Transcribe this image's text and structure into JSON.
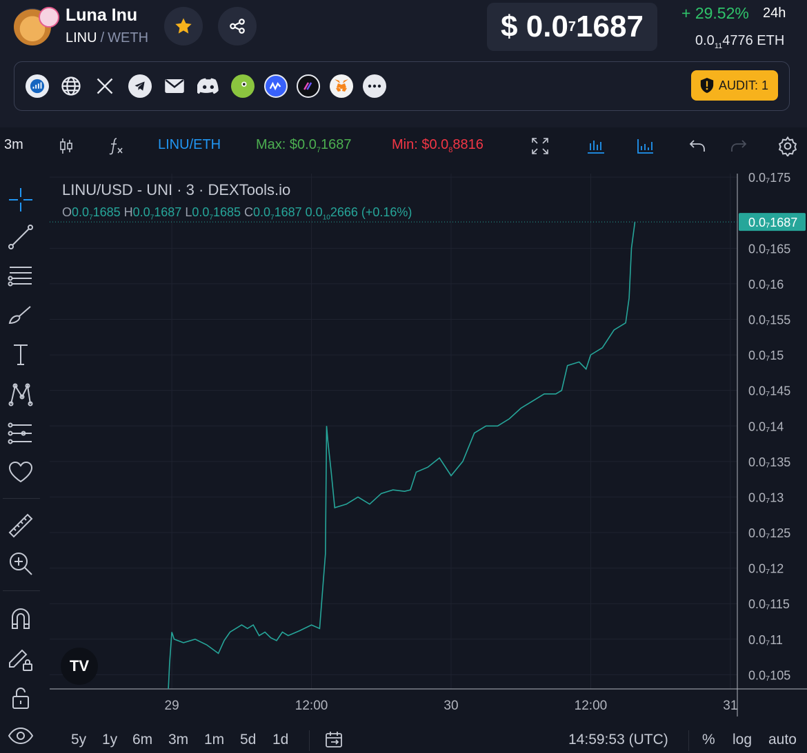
{
  "header": {
    "token_name": "Luna Inu",
    "pair_base": "LINU",
    "pair_sep": "/",
    "pair_quote": "WETH",
    "price_prefix": "$ 0.0",
    "price_sub": "7",
    "price_rest": "1687",
    "change": "+ 29.52%",
    "change_period": "24h",
    "eth_price_prefix": "0.0",
    "eth_price_sub": "11",
    "eth_price_rest": "4776",
    "eth_unit": "ETH",
    "audit_label": "AUDIT: 1"
  },
  "icons": {
    "star": "star-icon",
    "share": "share-icon",
    "dextools": "dextools-icon",
    "web": "globe-icon",
    "x": "x-icon",
    "telegram": "telegram-icon",
    "email": "email-icon",
    "discord": "discord-icon",
    "coingecko": "coingecko-icon",
    "cmc": "coinmarketcap-icon",
    "other": "app-icon",
    "metamask": "metamask-icon",
    "more": "more-icon",
    "shield": "shield-icon"
  },
  "toolbar": {
    "interval": "3m",
    "pair_link": "LINU/ETH",
    "max_label": "Max: $0.0",
    "max_sub": "7",
    "max_rest": "1687",
    "min_label": "Min: $0.0",
    "min_sub": "8",
    "min_rest": "8816"
  },
  "legend": {
    "title": "LINU/USD - UNI · 3 · DEXTools.io",
    "o_label": "O",
    "o_pre": "0.0",
    "o_sub": "7",
    "o_rest": "1685",
    "h_label": "H",
    "h_pre": "0.0",
    "h_sub": "7",
    "h_rest": "1687",
    "l_label": "L",
    "l_pre": "0.0",
    "l_sub": "7",
    "l_rest": "1685",
    "c_label": "C",
    "c_pre": "0.0",
    "c_sub": "7",
    "c_rest": "1687",
    "chg_pre": "0.0",
    "chg_sub": "10",
    "chg_rest": "2666",
    "chg_pct": "(+0.16%)"
  },
  "bottom": {
    "ranges": [
      "5y",
      "1y",
      "6m",
      "3m",
      "1m",
      "5d",
      "1d"
    ],
    "time": "14:59:53 (UTC)",
    "percent": "%",
    "log": "log",
    "auto": "auto"
  },
  "colors": {
    "up": "#26a69a",
    "down": "#ef5350",
    "price_tag": "#26a69a",
    "accent_blue": "#2196f3",
    "max": "#4caf50",
    "min": "#f23645"
  },
  "chart_data": {
    "type": "line",
    "ylim": [
      1.03e-07,
      1.755e-07
    ],
    "y_ticks": [
      {
        "v": 1.75e-07,
        "label": "0.0₇175"
      },
      {
        "v": 1.65e-07,
        "label": "0.0₇165"
      },
      {
        "v": 1.6e-07,
        "label": "0.0₇16"
      },
      {
        "v": 1.55e-07,
        "label": "0.0₇155"
      },
      {
        "v": 1.5e-07,
        "label": "0.0₇15"
      },
      {
        "v": 1.45e-07,
        "label": "0.0₇145"
      },
      {
        "v": 1.4e-07,
        "label": "0.0₇14"
      },
      {
        "v": 1.35e-07,
        "label": "0.0₇135"
      },
      {
        "v": 1.3e-07,
        "label": "0.0₇13"
      },
      {
        "v": 1.25e-07,
        "label": "0.0₇125"
      },
      {
        "v": 1.2e-07,
        "label": "0.0₇12"
      },
      {
        "v": 1.15e-07,
        "label": "0.0₇115"
      },
      {
        "v": 1.1e-07,
        "label": "0.0₇11"
      },
      {
        "v": 1.05e-07,
        "label": "0.0₇105"
      }
    ],
    "last_price": {
      "v": 1.687e-07,
      "label": "0.0₇1687"
    },
    "x_ticks": [
      {
        "h": 0,
        "label": "29"
      },
      {
        "h": 12,
        "label": "12:00"
      },
      {
        "h": 24,
        "label": "30"
      },
      {
        "h": 36,
        "label": "12:00"
      },
      {
        "h": 48,
        "label": "31"
      }
    ],
    "x_range_hours": [
      -10.5,
      48.6
    ],
    "series": [
      {
        "x": [
          -0.3,
          -0.2,
          0,
          0.2,
          1,
          2,
          3,
          4,
          4.5,
          5,
          6,
          6.5,
          7,
          7.5,
          8,
          8.5,
          9,
          9.5,
          10,
          11,
          12,
          12.7,
          13.2,
          13.3,
          13.4,
          13.7,
          14,
          15,
          16,
          17,
          18,
          19,
          20,
          20.5,
          21,
          22,
          23,
          24,
          25,
          26,
          27,
          28,
          29,
          30,
          31,
          32,
          33,
          33.5,
          34,
          35,
          35.6,
          36,
          37,
          38,
          39,
          39.3,
          39.5,
          39.8
        ],
        "y": [
          1.03e-07,
          1.065e-07,
          1.11e-07,
          1.1e-07,
          1.095e-07,
          1.1e-07,
          1.092e-07,
          1.08e-07,
          1.098e-07,
          1.11e-07,
          1.12e-07,
          1.115e-07,
          1.12e-07,
          1.105e-07,
          1.11e-07,
          1.102e-07,
          1.098e-07,
          1.11e-07,
          1.105e-07,
          1.112e-07,
          1.12e-07,
          1.115e-07,
          1.22e-07,
          1.4e-07,
          1.38e-07,
          1.335e-07,
          1.285e-07,
          1.29e-07,
          1.3e-07,
          1.29e-07,
          1.305e-07,
          1.31e-07,
          1.308e-07,
          1.31e-07,
          1.335e-07,
          1.342e-07,
          1.355e-07,
          1.33e-07,
          1.35e-07,
          1.39e-07,
          1.4e-07,
          1.4e-07,
          1.41e-07,
          1.425e-07,
          1.435e-07,
          1.445e-07,
          1.445e-07,
          1.45e-07,
          1.485e-07,
          1.49e-07,
          1.48e-07,
          1.5e-07,
          1.51e-07,
          1.535e-07,
          1.545e-07,
          1.58e-07,
          1.65e-07,
          1.687e-07
        ]
      }
    ]
  }
}
